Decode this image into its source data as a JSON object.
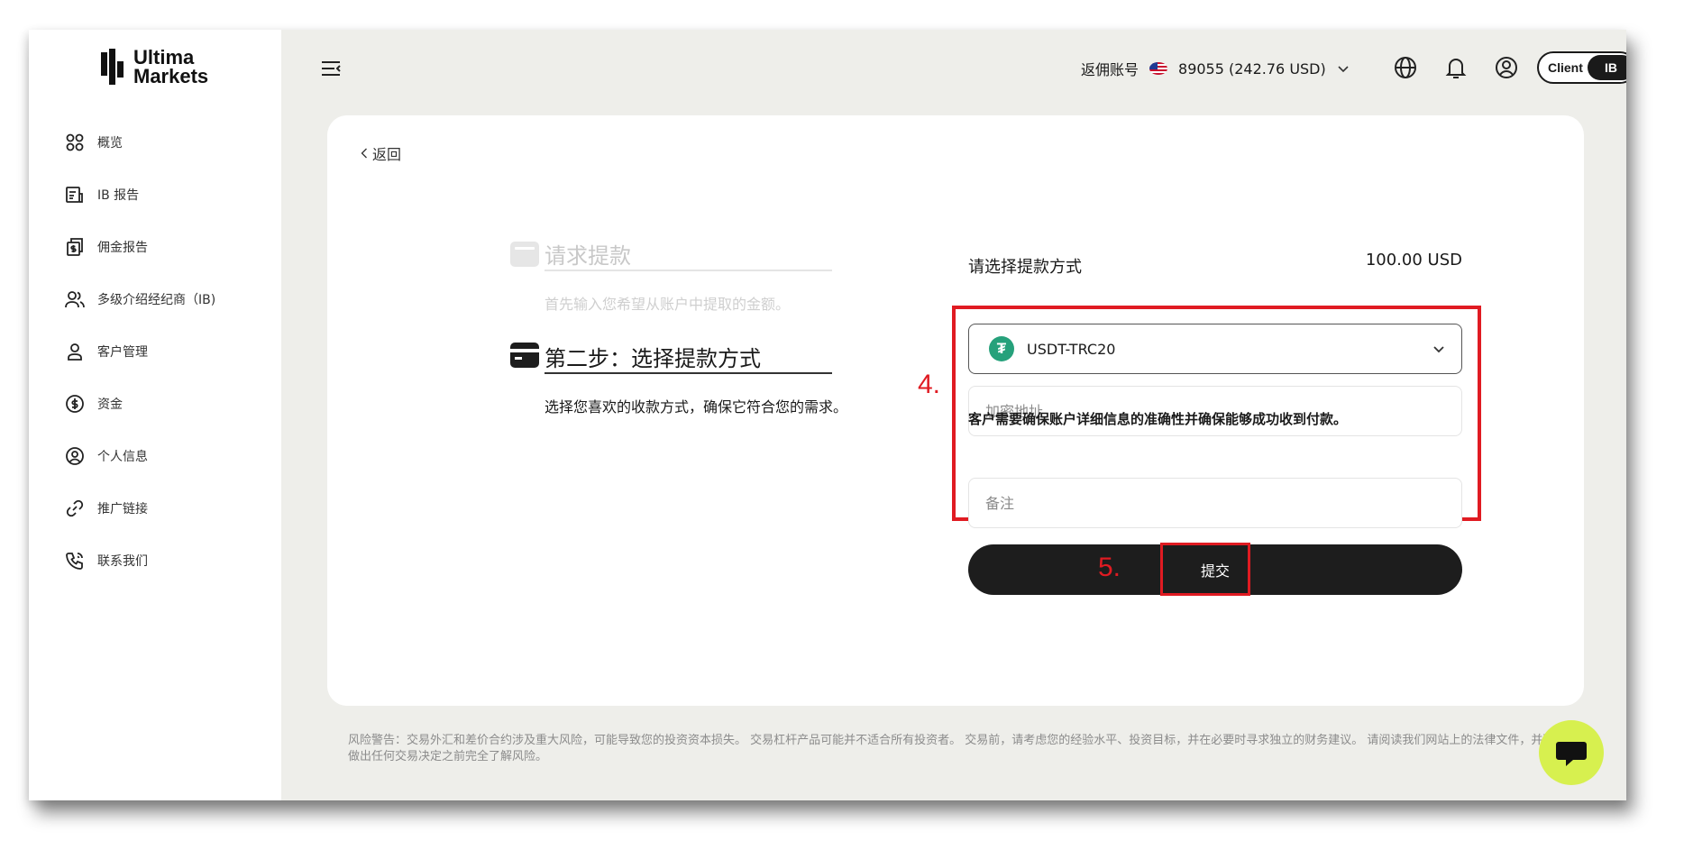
{
  "brand": {
    "name_line1": "Ultima",
    "name_line2": "Markets"
  },
  "sidebar": {
    "items": [
      {
        "label": "概览",
        "icon": "dashboard-icon"
      },
      {
        "label": "IB 报告",
        "icon": "report-icon"
      },
      {
        "label": "佣金报告",
        "icon": "commission-report-icon"
      },
      {
        "label": "多级介绍经纪商（IB)",
        "icon": "users-icon"
      },
      {
        "label": "客户管理",
        "icon": "user-icon"
      },
      {
        "label": "资金",
        "icon": "dollar-icon"
      },
      {
        "label": "个人信息",
        "icon": "profile-icon"
      },
      {
        "label": "推广链接",
        "icon": "link-icon"
      },
      {
        "label": "联系我们",
        "icon": "phone-icon"
      }
    ]
  },
  "topbar": {
    "account_label": "返佣账号",
    "account_value": "89055 (242.76 USD)",
    "toggle_client": "Client",
    "toggle_ib": "IB"
  },
  "page": {
    "back_label": "返回",
    "step1": {
      "title": "请求提款",
      "desc": "首先输入您希望从账户中提取的金额。"
    },
    "step2": {
      "title": "第二步：选择提款方式",
      "desc": "选择您喜欢的收款方式，确保它符合您的需求。"
    },
    "form": {
      "method_label": "请选择提款方式",
      "amount": "100.00 USD",
      "selected_method": "USDT-TRC20",
      "address_placeholder": "加密地址",
      "warning": "客户需要确保账户详细信息的准确性并确保能够成功收到付款。",
      "remark_placeholder": "备注",
      "submit_label": "提交"
    },
    "annotations": {
      "step4": "4.",
      "step5": "5."
    }
  },
  "footer": {
    "disclaimer": "风险警告：交易外汇和差价合约涉及重大风险，可能导致您的投资资本损失。 交易杠杆产品可能并不适合所有投资者。 交易前，请考虑您的经验水平、投资目标，并在必要时寻求独立的财务建议。 请阅读我们网站上的法律文件，并确保您在做出任何交易决定之前完全了解风险。"
  },
  "colors": {
    "accent_red": "#e01b22",
    "chat_bubble": "#d7f04f",
    "tether_green": "#26a17b",
    "button_dark": "#1d1d1d"
  }
}
